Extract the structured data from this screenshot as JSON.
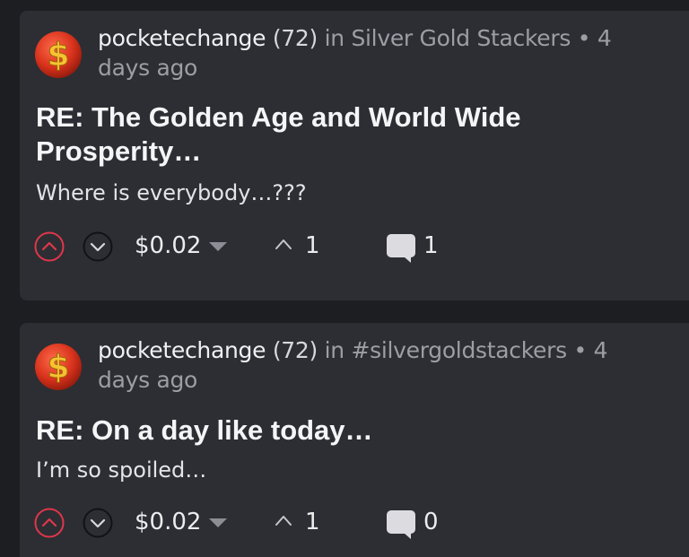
{
  "colors": {
    "page_background": "#1c1e22",
    "card_background": "#2c2e33",
    "upvote_accent": "#e0364b",
    "muted_text": "#9c9ea6"
  },
  "posts": [
    {
      "avatar_icon": "dollar-sign-icon",
      "author": "pocketechange",
      "reputation": "(72)",
      "in_label": "in",
      "community": "Silver Gold Stackers",
      "separator": "•",
      "age": "4 days ago",
      "title": "RE: The Golden Age and World Wide Prosperity…",
      "body": "Where is everybody…???",
      "payout": "$0.02",
      "votes": "1",
      "comments": "1"
    },
    {
      "avatar_icon": "dollar-sign-icon",
      "author": "pocketechange",
      "reputation": "(72)",
      "in_label": "in",
      "community": "#silvergoldstackers",
      "separator": "•",
      "age": "4 days ago",
      "title": "RE: On a day like today…",
      "body": "I’m so spoiled…",
      "payout": "$0.02",
      "votes": "1",
      "comments": "0"
    }
  ]
}
